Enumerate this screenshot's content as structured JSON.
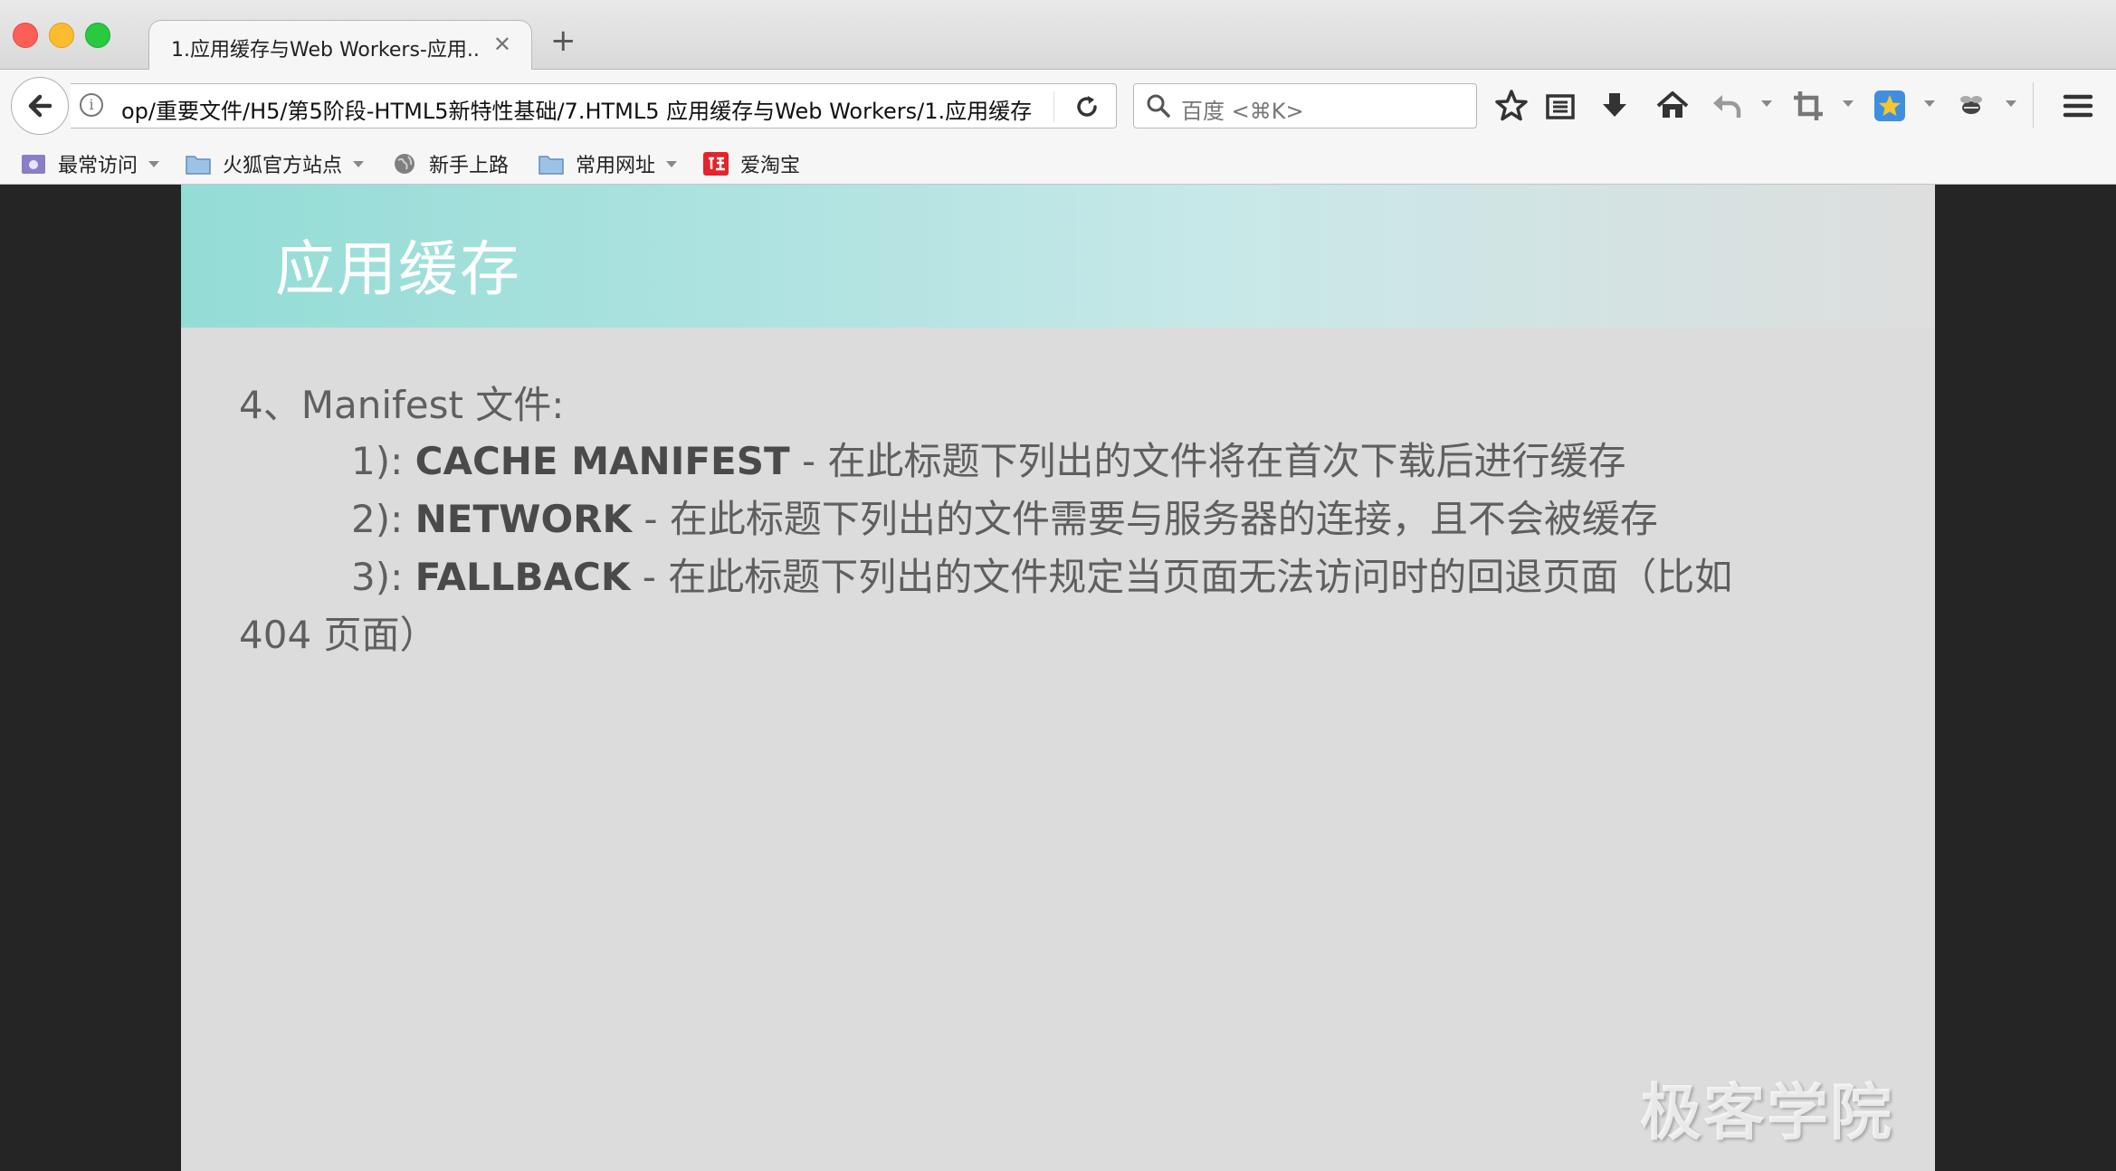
{
  "browser": {
    "tab": {
      "title": "1.应用缓存与Web Workers-应用...",
      "close": "✕"
    },
    "new_tab": "+",
    "url": "op/重要文件/H5/第5阶段-HTML5新特性基础/7.HTML5 应用缓存与Web Workers/1.应用缓存",
    "search_placeholder": "百度 <⌘K>",
    "toolbar_icons": [
      "back-icon",
      "info-icon",
      "reload-icon",
      "search-icon",
      "bookmark-star-icon",
      "reader-list-icon",
      "download-icon",
      "home-icon",
      "undo-icon",
      "crop-icon",
      "extension-star-icon",
      "extension-bee-icon",
      "menu-icon"
    ],
    "bookmarks": [
      {
        "label": "最常访问",
        "icon": "most-visited-icon",
        "dropdown": true
      },
      {
        "label": "火狐官方站点",
        "icon": "folder-icon",
        "dropdown": true
      },
      {
        "label": "新手上路",
        "icon": "globe-icon",
        "dropdown": false
      },
      {
        "label": "常用网址",
        "icon": "folder-icon",
        "dropdown": true
      },
      {
        "label": "爱淘宝",
        "icon": "taobao-icon",
        "dropdown": false
      }
    ]
  },
  "slide": {
    "title": "应用缓存",
    "heading": "4、Manifest 文件:",
    "items": [
      {
        "num": "1):",
        "term": "CACHE MANIFEST",
        "desc": " - 在此标题下列出的文件将在首次下载后进行缓存"
      },
      {
        "num": "2):",
        "term": "NETWORK",
        "desc": " - 在此标题下列出的文件需要与服务器的连接，且不会被缓存"
      },
      {
        "num": "3):",
        "term": "FALLBACK",
        "desc": " - 在此标题下列出的文件规定当页面无法访问时的回退页面（比如"
      }
    ],
    "continuation": "404 页面）",
    "watermark": "极客学院"
  },
  "colors": {
    "header_gradient_start": "#94dcd6",
    "slide_background": "#dcdcdc",
    "text": "#5f5f5f",
    "close": "#fc5f57",
    "minimize": "#fdbc2e",
    "maximize": "#29c940"
  }
}
